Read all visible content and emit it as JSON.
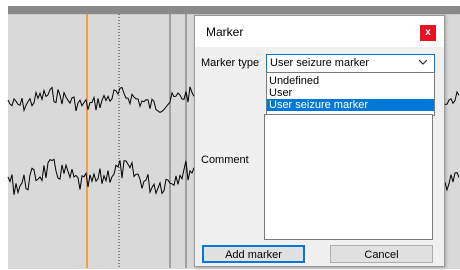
{
  "dialog": {
    "title": "Marker",
    "close_label": "x",
    "marker_type_label": "Marker type",
    "marker_type_value": "User seizure marker",
    "options": [
      "Undefined",
      "User",
      "User seizure marker"
    ],
    "selected_option_index": 2,
    "comment_label": "Comment",
    "comment_value": "",
    "add_button": "Add marker",
    "cancel_button": "Cancel"
  },
  "colors": {
    "accent": "#0078d7",
    "close_button": "#e81123",
    "marker_line": "#f0a040",
    "eeg_trace": "#000000"
  },
  "icons": {
    "close": "close-icon",
    "dropdown": "chevron-down-icon"
  }
}
